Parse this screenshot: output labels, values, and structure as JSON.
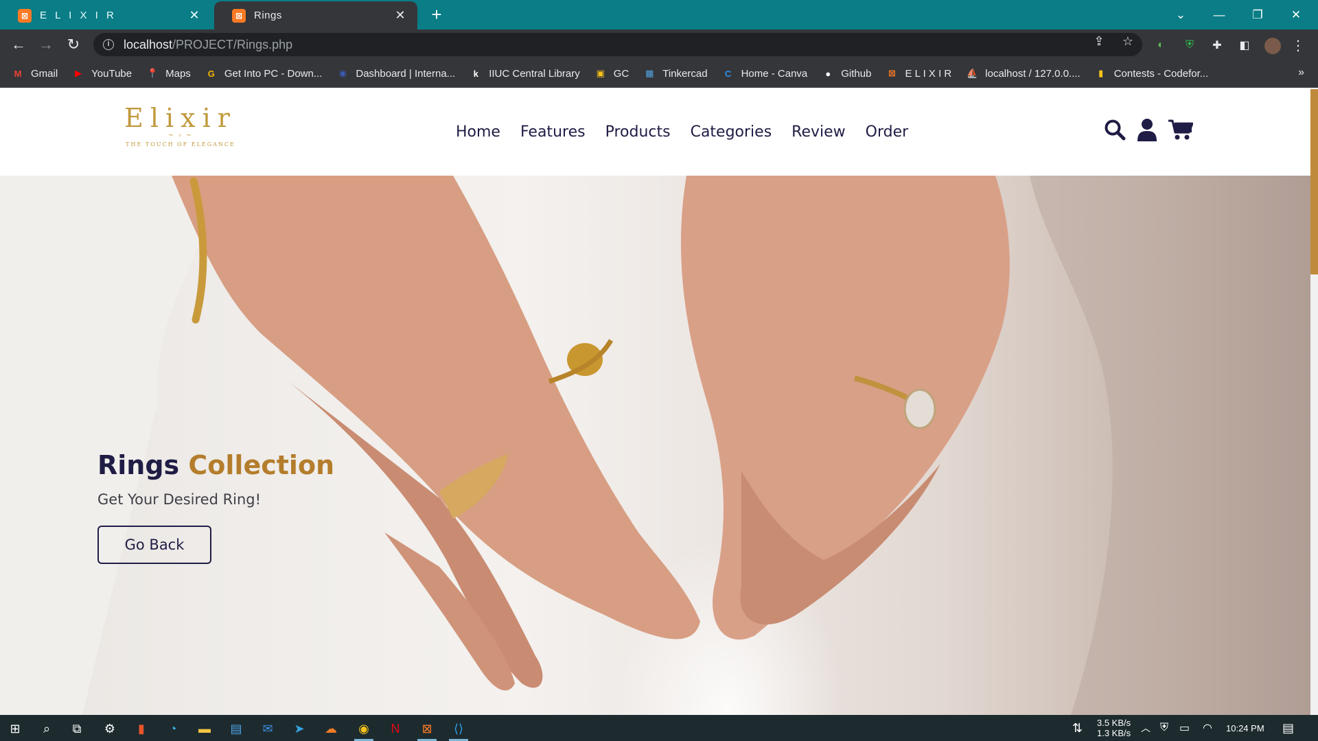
{
  "browser": {
    "tabs": [
      {
        "title": "E L I X I R",
        "favicon": "xampp-icon"
      },
      {
        "title": "Rings",
        "favicon": "xampp-icon"
      }
    ],
    "address": {
      "host": "localhost",
      "path": "/PROJECT/Rings.php"
    },
    "bookmarks": [
      {
        "label": "Gmail",
        "icon": "gmail-icon",
        "color": "#ea4335",
        "glyph": "M"
      },
      {
        "label": "YouTube",
        "icon": "youtube-icon",
        "color": "#ff0000",
        "glyph": "▶"
      },
      {
        "label": "Maps",
        "icon": "maps-icon",
        "color": "#34a853",
        "glyph": "📍"
      },
      {
        "label": "Get Into PC - Down...",
        "icon": "getintopc-icon",
        "color": "#f5b400",
        "glyph": "G"
      },
      {
        "label": "Dashboard | Interna...",
        "icon": "dashboard-icon",
        "color": "#3b5bb5",
        "glyph": "◉"
      },
      {
        "label": "IIUC Central Library",
        "icon": "library-icon",
        "color": "#ffffff",
        "glyph": "k"
      },
      {
        "label": "GC",
        "icon": "classroom-icon",
        "color": "#f7c21b",
        "glyph": "▣"
      },
      {
        "label": "Tinkercad",
        "icon": "tinkercad-icon",
        "color": "#4fa3e0",
        "glyph": "▦"
      },
      {
        "label": "Home - Canva",
        "icon": "canva-icon",
        "color": "#2f8fe8",
        "glyph": "C"
      },
      {
        "label": "Github",
        "icon": "github-icon",
        "color": "#ffffff",
        "glyph": "●"
      },
      {
        "label": "E L I X I R",
        "icon": "xampp-icon",
        "color": "#fb7a24",
        "glyph": "⊠"
      },
      {
        "label": "localhost / 127.0.0....",
        "icon": "phpmyadmin-icon",
        "color": "#e8a33b",
        "glyph": "⛵"
      },
      {
        "label": "Contests - Codefor...",
        "icon": "codeforces-icon",
        "color": "#f5c518",
        "glyph": "▮"
      }
    ]
  },
  "site": {
    "logo": {
      "word": "Elixir",
      "tagline": "THE TOUCH OF ELEGANCE"
    },
    "nav": [
      "Home",
      "Features",
      "Products",
      "Categories",
      "Review",
      "Order"
    ],
    "hero": {
      "title_part1": "Rings",
      "title_part2": "Collection",
      "subtitle": "Get Your Desired Ring!",
      "button": "Go Back"
    },
    "colors": {
      "navy": "#1f1c45",
      "gold": "#b47d2c",
      "logo_gold": "#c19a3d"
    }
  },
  "taskbar": {
    "net_down": "3.5 KB/s",
    "net_up": "1.3 KB/s",
    "time": "10:24 PM"
  }
}
